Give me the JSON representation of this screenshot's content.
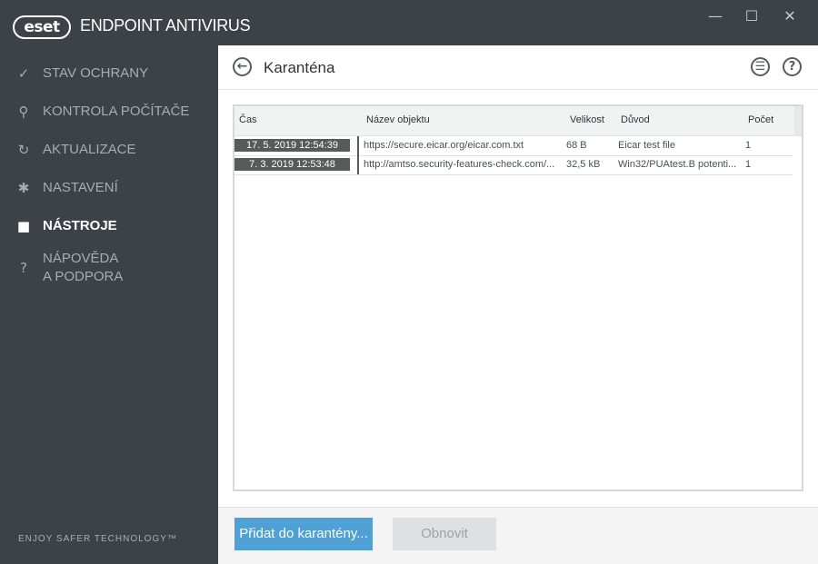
{
  "app": {
    "logo_text": "eset",
    "title": "ENDPOINT ANTIVIRUS",
    "window_controls": {
      "minimize": "—",
      "maximize": "☐",
      "close": "✕"
    }
  },
  "sidebar": {
    "items": [
      {
        "label": "STAV OCHRANY",
        "icon": "check-icon",
        "glyph": "✓"
      },
      {
        "label": "KONTROLA POČÍTAČE",
        "icon": "search-icon",
        "glyph": "⚲"
      },
      {
        "label": "AKTUALIZACE",
        "icon": "refresh-icon",
        "glyph": "↻"
      },
      {
        "label": "NASTAVENÍ",
        "icon": "gear-icon",
        "glyph": "✱"
      },
      {
        "label": "NÁSTROJE",
        "icon": "toolbox-icon",
        "glyph": "■",
        "active": true
      },
      {
        "label_line1": "NÁPOVĚDA",
        "label_line2": "A PODPORA",
        "icon": "help-icon",
        "glyph": "?"
      }
    ],
    "tagline": "ENJOY SAFER TECHNOLOGY™"
  },
  "main": {
    "back_glyph": "←",
    "title": "Karanténa",
    "header_icons": [
      {
        "icon": "list-view-icon",
        "glyph": "☰"
      },
      {
        "icon": "help-icon",
        "glyph": "?"
      }
    ],
    "table": {
      "columns": [
        "Čas",
        "Název objektu",
        "Velikost",
        "Důvod",
        "Počet"
      ],
      "rows": [
        {
          "time": "17. 5. 2019 12:54:39",
          "name": "https://secure.eicar.org/eicar.com.txt",
          "size": "68 B",
          "reason": "Eicar test file",
          "count": "1"
        },
        {
          "time": "7. 3. 2019 12:53:48",
          "name": "http://amtso.security-features-check.com/...",
          "size": "32,5 kB",
          "reason": "Win32/PUAtest.B potenti...",
          "count": "1"
        }
      ]
    },
    "footer": {
      "add_button": "Přidat do karantény...",
      "refresh_button": "Obnovit"
    }
  },
  "colors": {
    "sidebar_bg": "#3c4247",
    "accent_button": "#4ea0d5",
    "selected_time_bg": "#58595b"
  }
}
